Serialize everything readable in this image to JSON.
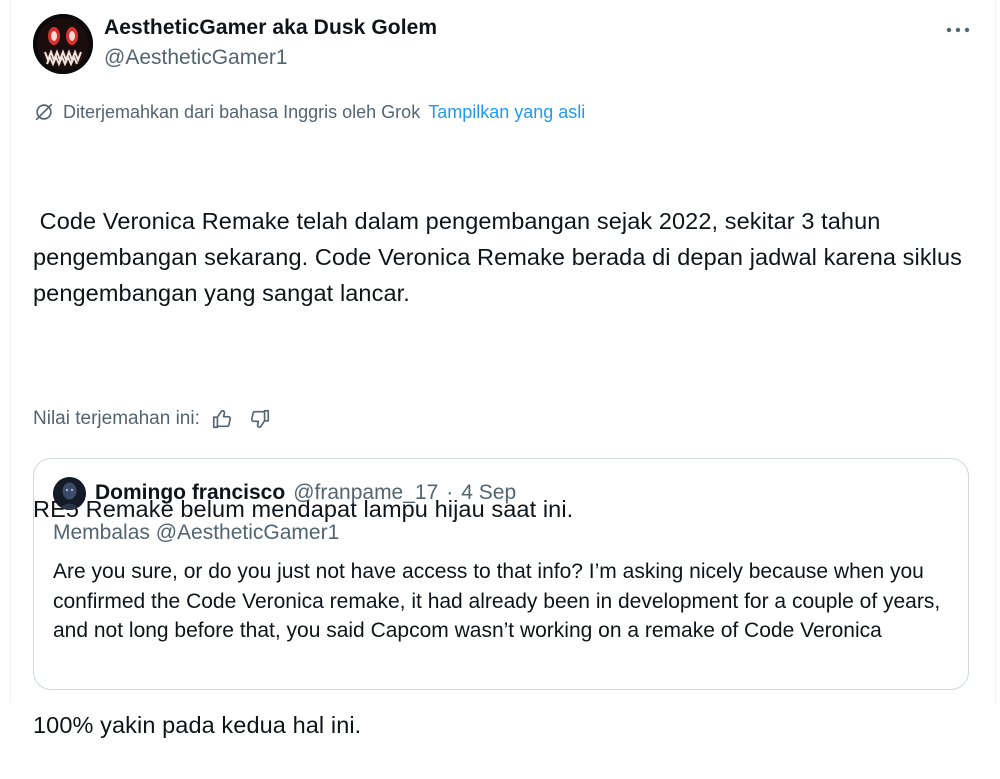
{
  "tweet": {
    "author": {
      "name": "AestheticGamer aka Dusk Golem",
      "handle": "@AestheticGamer1"
    },
    "translation": {
      "note": "Diterjemahkan dari bahasa Inggris oleh Grok",
      "show_original": "Tampilkan yang asli"
    },
    "paragraphs": [
      " Code Veronica Remake telah dalam pengembangan sejak 2022, sekitar 3 tahun pengembangan sekarang. Code Veronica Remake berada di depan jadwal karena siklus pengembangan yang sangat lancar.",
      "RE5 Remake belum mendapat lampu hijau saat ini.",
      "100% yakin pada kedua hal ini."
    ],
    "rate_label": "Nilai terjemahan ini:"
  },
  "quote": {
    "name": "Domingo francisco",
    "handle": "@franpame_17",
    "separator": "·",
    "date": "4 Sep",
    "replying_to": "Membalas @AestheticGamer1",
    "text": "Are you sure, or do you just not have access to that info? I’m asking nicely because when you confirmed the Code Veronica remake, it had already been in development for a couple of years, and not long before that, you said Capcom wasn’t working on a remake of Code Veronica"
  },
  "icons": {
    "more": "more-icon",
    "grok": "grok-icon",
    "thumbs_up": "thumbs-up-icon",
    "thumbs_down": "thumbs-down-icon"
  },
  "colors": {
    "text": "#0f1419",
    "secondary": "#536471",
    "link": "#1d9bf0",
    "border": "#cfd9de"
  }
}
